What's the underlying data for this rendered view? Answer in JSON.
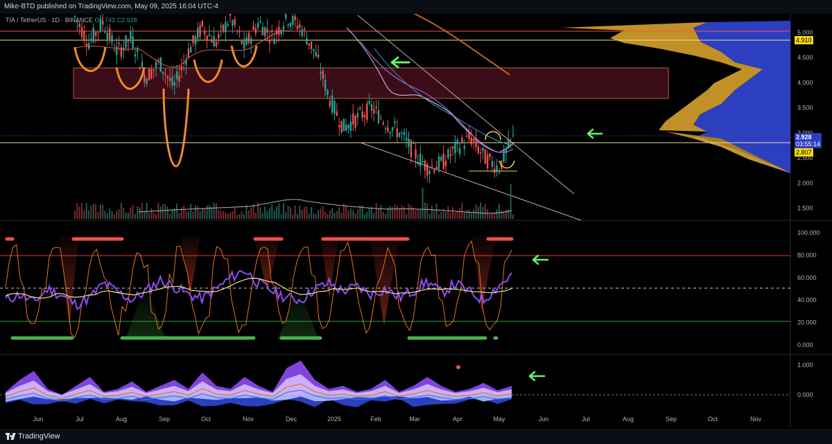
{
  "header": {
    "publish_line": "Mike-BTD published on TradingView.com, May 09, 2025 16:04 UTC-4"
  },
  "legend": {
    "symbol": "TIA / TetherUS · 1D · BINANCE",
    "open": "O2.743",
    "close": "C2.928"
  },
  "price_labels": {
    "last": "2.928",
    "countdown": "03:55:14",
    "yellow_top": "4.910",
    "yellow_bottom": "2.807"
  },
  "footer": {
    "brand": "TradingView"
  },
  "colors": {
    "background": "#000000",
    "upper_line": "#ff5252",
    "yellow_line": "#f0e68c",
    "box_fill": "#3a0d18",
    "volume_profile_blue": "#2b3fbf",
    "volume_profile_gold": "#d6a02a",
    "purple": "#8d4df5",
    "orange": "#e8731c",
    "green_arrow": "#63f56a"
  },
  "chart_data": [
    {
      "type": "line",
      "pane": "price",
      "yaxis": {
        "ticks": [
          "5.000",
          "4.500",
          "4.000",
          "3.500",
          "3.000",
          "2.500",
          "2.000",
          "1.500"
        ],
        "ylim": [
          1.3,
          5.3
        ],
        "scale": "linear"
      },
      "xaxis": {
        "ticks": [
          "Jun",
          "Jul",
          "Aug",
          "Sep",
          "Oct",
          "Nov",
          "Dec",
          "2025",
          "Feb",
          "Mar",
          "Apr",
          "May",
          "Jun",
          "Jul",
          "Aug",
          "Sep",
          "Oct",
          "Nov"
        ]
      },
      "series": [
        {
          "values": [
            5.3,
            4.8,
            5.2,
            4.6,
            4.9,
            4.1,
            4.4,
            3.9,
            4.6,
            5.1,
            4.8,
            5.3,
            4.7,
            5.2,
            4.9,
            5.3,
            5.1,
            4.6,
            3.7,
            3.1,
            3.3,
            3.5,
            3.2,
            3.0,
            2.6,
            2.3,
            2.4,
            2.7,
            2.9,
            2.5,
            2.3,
            2.9
          ]
        }
      ],
      "levels": [
        5.08,
        4.91,
        2.807,
        2.928
      ],
      "zone": [
        3.72,
        4.32
      ]
    },
    {
      "type": "line",
      "pane": "oscillator",
      "yaxis": {
        "ticks": [
          "100.000",
          "80.000",
          "60.000",
          "40.000",
          "20.000",
          "0.000"
        ],
        "ylim": [
          -5,
          105
        ]
      },
      "levels": [
        80,
        50,
        20
      ],
      "series": [
        {
          "values": [
            40,
            45,
            38,
            50,
            44,
            36,
            42,
            55,
            47,
            40,
            48,
            58,
            52,
            45,
            41,
            50,
            60,
            67,
            55,
            48,
            42,
            40,
            50,
            55,
            48,
            52,
            45,
            50,
            42,
            48,
            57,
            46,
            55,
            47,
            40,
            52,
            62
          ]
        },
        {
          "values": [
            44,
            46,
            42,
            43,
            46,
            42,
            44,
            48,
            47,
            45,
            46,
            50,
            52,
            50,
            47,
            47,
            52,
            58,
            60,
            56,
            50,
            45,
            46,
            49,
            50,
            50,
            48,
            48,
            46,
            46,
            50,
            49,
            50,
            49,
            46,
            47,
            50
          ]
        }
      ]
    },
    {
      "type": "area",
      "pane": "momentum",
      "yaxis": {
        "ticks": [
          "1.000",
          "0.000"
        ],
        "ylim": [
          -0.3,
          1.2
        ]
      },
      "levels": [
        0
      ],
      "series": [
        {
          "values": [
            0.1,
            0.5,
            0.8,
            0.2,
            -0.1,
            0.3,
            0.6,
            0.1,
            0.2,
            0.45,
            0.1,
            0.3,
            0.5,
            0.2,
            0.75,
            0.3,
            0.2,
            0.6,
            0.3,
            0.1,
            0.9,
            1.15,
            0.5,
            0.2,
            0.3,
            0.1,
            0.2,
            0.5,
            0.1,
            0.3,
            0.6,
            0.3,
            0.1,
            0.2,
            0.4,
            0.15,
            0.3
          ]
        }
      ]
    }
  ]
}
